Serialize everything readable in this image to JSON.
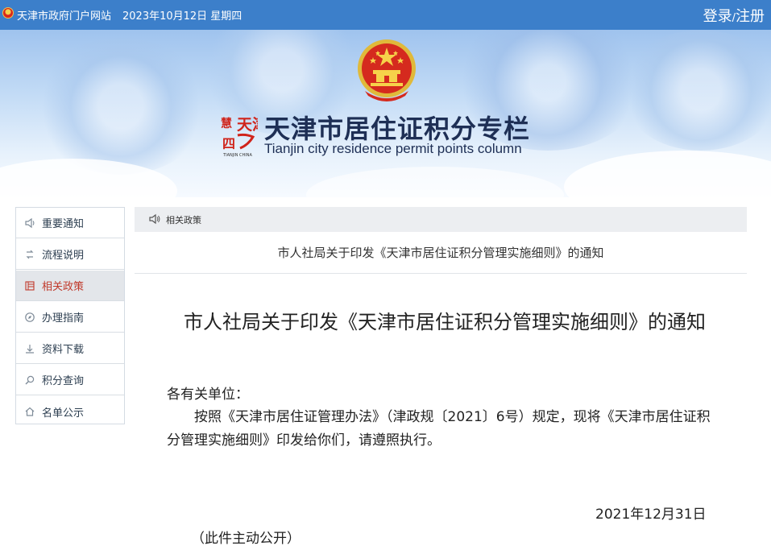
{
  "topbar": {
    "site_name": "天津市政府门户网站",
    "date": "2023年10月12日 星期四",
    "login": "登录",
    "separator": "/",
    "register": "注册"
  },
  "banner": {
    "title": "天津市居住证积分专栏",
    "subtitle": "Tianjin city residence permit points column",
    "seal_text": "天津",
    "seal_caption": "TIANJIN CHINA"
  },
  "sidebar": {
    "items": [
      {
        "label": "重要通知",
        "icon": "speaker-icon"
      },
      {
        "label": "流程说明",
        "icon": "flow-icon"
      },
      {
        "label": "相关政策",
        "icon": "document-icon",
        "active": true
      },
      {
        "label": "办理指南",
        "icon": "compass-icon"
      },
      {
        "label": "资料下载",
        "icon": "download-icon"
      },
      {
        "label": "积分查询",
        "icon": "search-icon"
      },
      {
        "label": "名单公示",
        "icon": "home-icon"
      }
    ]
  },
  "main": {
    "breadcrumb": "相关政策",
    "topic_title": "市人社局关于印发《天津市居住证积分管理实施细则》的通知",
    "article": {
      "title": "市人社局关于印发《天津市居住证积分管理实施细则》的通知",
      "salutation": "各有关单位：",
      "body": "按照《天津市居住证管理办法》（津政规〔2021〕6号）规定，现将《天津市居住证积分管理实施细则》印发给你们，请遵照执行。",
      "date": "2021年12月31日",
      "note": "（此件主动公开）"
    }
  },
  "colors": {
    "topbar": "#3c7fca",
    "active_nav_text": "#c0392b",
    "title_text": "#1e2f55"
  }
}
